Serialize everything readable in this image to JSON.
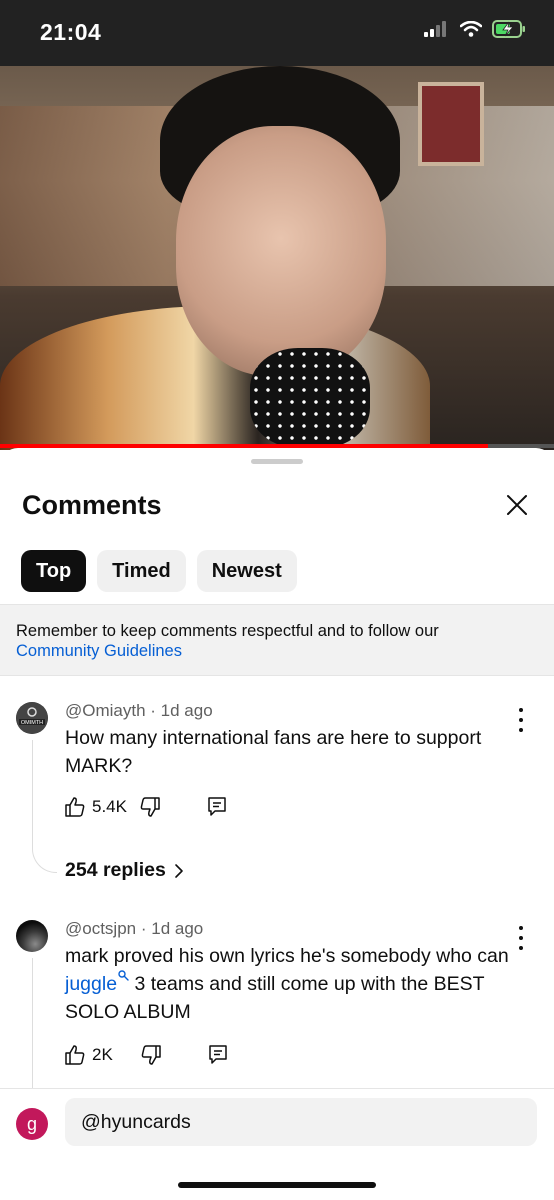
{
  "status_bar": {
    "time": "21:04"
  },
  "video": {
    "progress": 0.88
  },
  "sheet": {
    "title": "Comments",
    "tabs": [
      {
        "label": "Top",
        "active": true
      },
      {
        "label": "Timed",
        "active": false
      },
      {
        "label": "Newest",
        "active": false
      }
    ],
    "notice": {
      "text": "Remember to keep comments respectful and to follow our",
      "link": "Community Guidelines"
    }
  },
  "comments": [
    {
      "author": "@Omiayth",
      "time": "1d ago",
      "avatar_text": "OMIMTH",
      "text": "How many international fans are here to support MARK?",
      "likes": "5.4K",
      "replies": "254 replies"
    },
    {
      "author": "@octsjpn",
      "time": "1d ago",
      "text_before": "mark proved his own lyrics he's somebody who can",
      "link_word": "juggle",
      "text_after": "3 teams and still come up with the BEST SOLO ALBUM",
      "likes": "2K"
    }
  ],
  "composer": {
    "avatar_letter": "g",
    "value": "@hyuncards"
  },
  "colors": {
    "accent_red": "#ff0000",
    "link_blue": "#065fd4",
    "avatar_pink": "#c2185b"
  },
  "icons": [
    "cellular-icon",
    "wifi-icon",
    "battery-charging-icon",
    "close-icon",
    "more-vert-icon",
    "thumb-up-icon",
    "thumb-down-icon",
    "reply-icon",
    "search-link-icon",
    "chevron-right-icon"
  ]
}
